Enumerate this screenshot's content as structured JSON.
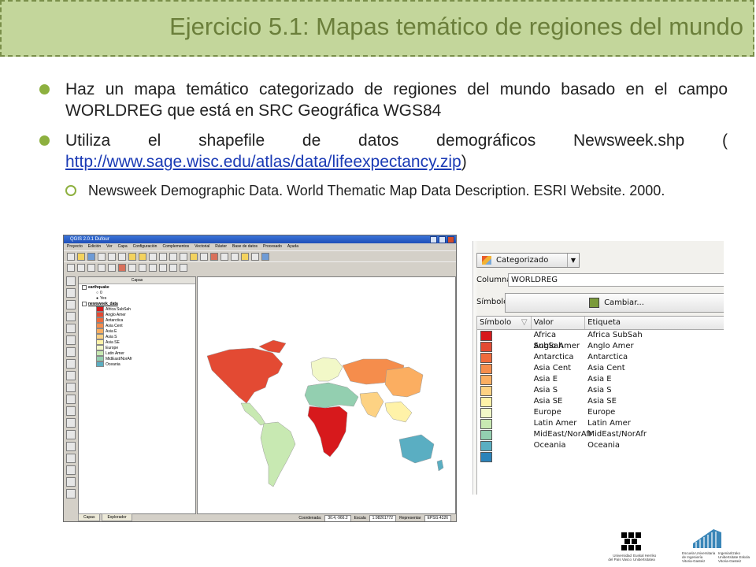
{
  "title": "Ejercicio 5.1: Mapas temático de regiones del mundo",
  "bullet1": "Haz un mapa temático categorizado de regiones del mundo basado en el campo WORLDREG que está en SRC Geográfica WGS84",
  "bullet2_text": "Utiliza el shapefile de datos demográficos Newsweek.shp (",
  "bullet2_link": "http://www.sage.wisc.edu/atlas/data/lifeexpectancy.zip",
  "bullet2_close": ")",
  "sub_bullet": "Newsweek Demographic Data. World Thematic Map Data Description. ESRI Website. 2000.",
  "qgis": {
    "window_title": "QGIS 2.0.1 Dufour",
    "menu": [
      "Proyecto",
      "Edición",
      "Ver",
      "Capa",
      "Configuración",
      "Complementos",
      "Vectorial",
      "Ráster",
      "Base de datos",
      "Procesado",
      "Ayuda"
    ],
    "layers_header": "Capas",
    "layers": [
      {
        "name": "earthquake",
        "items": [
          "0",
          "Yes"
        ]
      },
      {
        "name": "newsweek_data",
        "items": [
          "Africa SubSah",
          "Anglo Amer",
          "Antarctica",
          "Asia Cent",
          "Asia E",
          "Asia S",
          "Asia SE",
          "Europe",
          "Latin Amer",
          "MidEast/NorAfr",
          "Oceania"
        ]
      }
    ],
    "tabs": [
      "Capas",
      "Explorador"
    ],
    "status": {
      "coord_label": "Coordenada:",
      "coord_value": "30.4,-966.2",
      "scale_label": "Escala",
      "scale_value": "1:98261772",
      "render_label": "Representar",
      "crs": "EPSG:4326"
    }
  },
  "style_panel": {
    "renderer": "Categorizado",
    "column_label": "Columna",
    "column_value": "WORLDREG",
    "symbol_label": "Símbolo",
    "change_button": "Cambiar...",
    "headers": [
      "Símbolo",
      "Valor",
      "Etiqueta"
    ],
    "rows": [
      {
        "value": "Africa SubSah",
        "label": "Africa SubSah",
        "color": "#d7191c"
      },
      {
        "value": "Anglo Amer",
        "label": "Anglo Amer",
        "color": "#e34a33"
      },
      {
        "value": "Antarctica",
        "label": "Antarctica",
        "color": "#ef6a3c"
      },
      {
        "value": "Asia Cent",
        "label": "Asia Cent",
        "color": "#f58d4c"
      },
      {
        "value": "Asia E",
        "label": "Asia E",
        "color": "#fbae61"
      },
      {
        "value": "Asia S",
        "label": "Asia S",
        "color": "#fdd283"
      },
      {
        "value": "Asia SE",
        "label": "Asia SE",
        "color": "#fff2a8"
      },
      {
        "value": "Europe",
        "label": "Europe",
        "color": "#f2f8c8"
      },
      {
        "value": "Latin Amer",
        "label": "Latin Amer",
        "color": "#c8e9b2"
      },
      {
        "value": "MidEast/NorAfr",
        "label": "MidEast/NorAfr",
        "color": "#93cfb0"
      },
      {
        "value": "Oceania",
        "label": "Oceania",
        "color": "#5aaec2"
      },
      {
        "value": "",
        "label": "",
        "color": "#2b83ba"
      }
    ]
  },
  "logos": {
    "upv_lines": [
      "Universidad",
      "del País Vasco"
    ],
    "upv_lines2": [
      "Euskal Herriko",
      "Unibertsitatea"
    ],
    "eue_lines": [
      "Escuela Universitaria",
      "de Ingeniería",
      "Vitoria-Gasteiz"
    ],
    "eue_lines2": [
      "Ingeniaritzako",
      "Unibertsitate Eskola",
      "Vitoria-Gasteiz"
    ]
  }
}
